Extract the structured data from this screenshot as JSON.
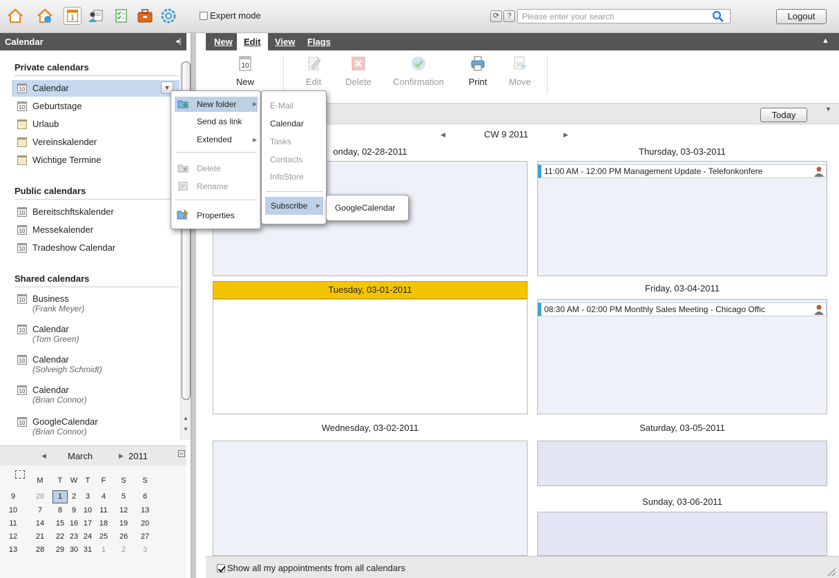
{
  "topbar": {
    "app_icons": [
      "home-icon",
      "portal-icon",
      "calendar-icon",
      "contacts-icon",
      "tasks-icon",
      "infostore-icon",
      "settings-icon"
    ],
    "expert_mode_label": "Expert mode",
    "refresh_glyph": "⟳",
    "help_glyph": "?",
    "search_placeholder": "Please enter your search",
    "logout_label": "Logout"
  },
  "left": {
    "header": "Calendar",
    "collapse_glyph": "◂||",
    "private_title": "Private calendars",
    "private_items": [
      "Calendar",
      "Geburtstage",
      "Urlaub",
      "Vereinskalender",
      "Wichtige Termine"
    ],
    "public_title": "Public calendars",
    "public_items": [
      "Bereitschftskalender",
      "Messekalender",
      "Tradeshow Calendar"
    ],
    "shared_title": "Shared calendars",
    "shared_items": [
      {
        "name": "Business",
        "owner": "(Frank Meyer)"
      },
      {
        "name": "Calendar",
        "owner": "(Tom Green)"
      },
      {
        "name": "Calendar",
        "owner": "(Solveigh Schmidt)"
      },
      {
        "name": "Calendar",
        "owner": "(Brian Connor)"
      },
      {
        "name": "GoogleCalendar",
        "owner": "(Brian Connor)"
      }
    ]
  },
  "minical": {
    "month": "March",
    "year": "2011",
    "weekdays": [
      "M",
      "T",
      "W",
      "T",
      "F",
      "S",
      "S"
    ],
    "weeks": [
      "9",
      "10",
      "11",
      "12",
      "13"
    ],
    "days": [
      [
        "28",
        "1",
        "2",
        "3",
        "4",
        "5",
        "6"
      ],
      [
        "7",
        "8",
        "9",
        "10",
        "11",
        "12",
        "13"
      ],
      [
        "14",
        "15",
        "16",
        "17",
        "18",
        "19",
        "20"
      ],
      [
        "21",
        "22",
        "23",
        "24",
        "25",
        "26",
        "27"
      ],
      [
        "28",
        "29",
        "30",
        "31",
        "1",
        "2",
        "3"
      ]
    ]
  },
  "menubar": {
    "tabs": [
      "New",
      "Edit",
      "View",
      "Flags"
    ],
    "active": "Edit"
  },
  "toolbar": {
    "new_label": "New",
    "edit_label": "Edit",
    "delete_label": "Delete",
    "confirmation_label": "Confirmation",
    "print_label": "Print",
    "move_label": "Move",
    "icon_day_number": "10"
  },
  "calendar": {
    "week_label": "CW 9 2011",
    "today_label": "Today",
    "days": {
      "mon": "Monday, 02-28-2011",
      "tue": "Tuesday, 03-01-2011",
      "wed": "Wednesday, 03-02-2011",
      "thu": "Thursday, 03-03-2011",
      "fri": "Friday, 03-04-2011",
      "sat": "Saturday, 03-05-2011",
      "sun": "Sunday, 03-06-2011"
    },
    "mon_visible": "onday, 02-28-2011",
    "appointments": {
      "thu": "11:00 AM - 12:00 PM Management Update - Telefonkonfere",
      "fri": "08:30 AM - 02:00 PM Monthly Sales Meeting - Chicago Offic"
    },
    "footer_label": "Show all my appointments from all calendars"
  },
  "context_menu": {
    "new_folder": "New folder",
    "send_as_link": "Send as link",
    "extended": "Extended",
    "delete": "Delete",
    "rename": "Rename",
    "properties": "Properties"
  },
  "submenu": {
    "email": "E-Mail",
    "calendar": "Calendar",
    "tasks": "Tasks",
    "contacts": "Contacts",
    "infostore": "InfoStore",
    "subscribe": "Subscribe"
  },
  "subsubmenu": {
    "google": "GoogleCalendar"
  },
  "colors": {
    "accent_blue": "#3ea0d8",
    "today_yellow": "#f5c400",
    "header_dark": "#555555",
    "selected_blue": "#c6d8ee"
  }
}
